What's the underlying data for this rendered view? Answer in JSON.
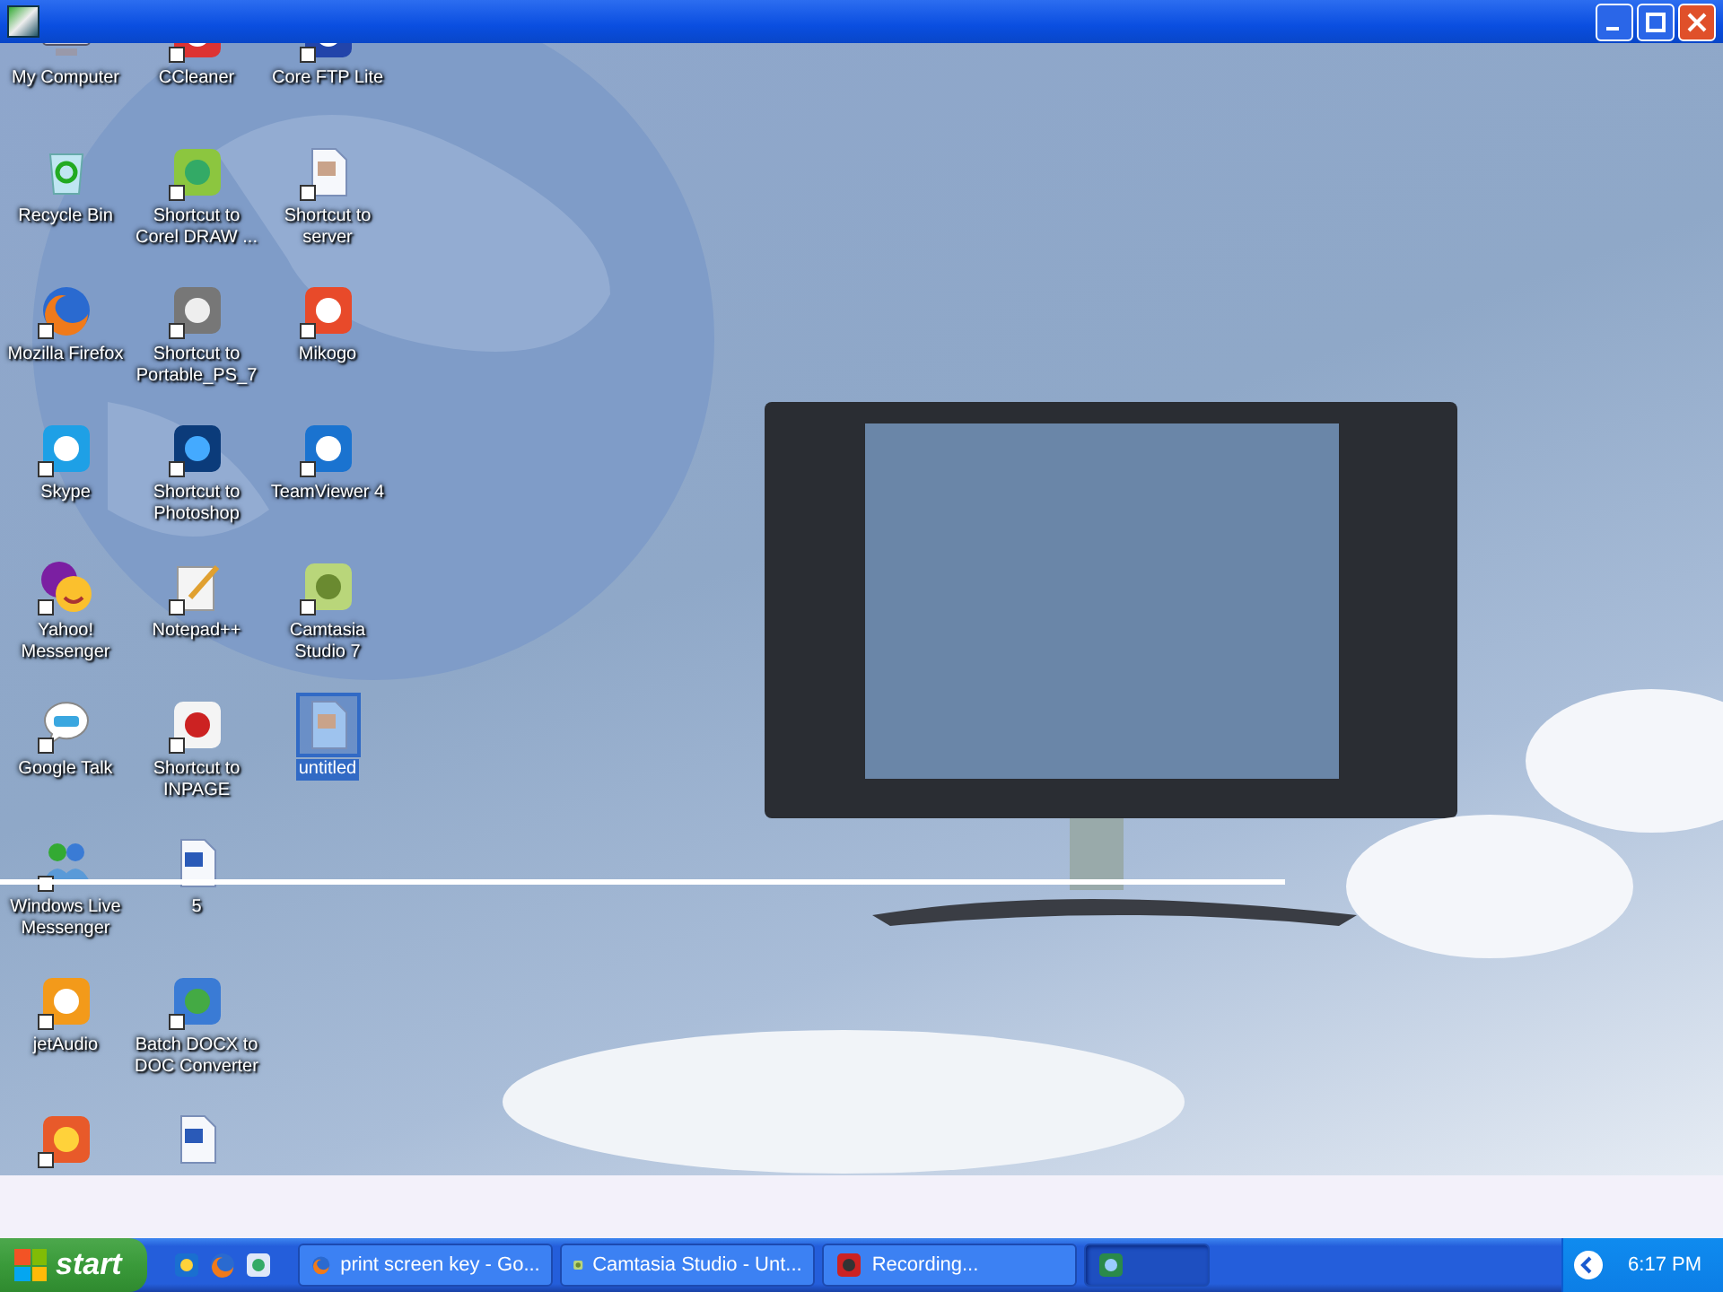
{
  "window": {
    "buttons": [
      {
        "kind": "minimize"
      },
      {
        "kind": "maximize"
      },
      {
        "kind": "close"
      }
    ]
  },
  "desktop_icons": [
    {
      "label": "My Computer",
      "kind": "computer",
      "shortcut": false,
      "selected": false
    },
    {
      "label": "Recycle Bin",
      "kind": "bin",
      "shortcut": false,
      "selected": false
    },
    {
      "label": "Mozilla Firefox",
      "kind": "browser",
      "shortcut": true,
      "selected": false
    },
    {
      "label": "Skype",
      "kind": "skype",
      "shortcut": true,
      "selected": false
    },
    {
      "label": "Yahoo! Messenger",
      "kind": "yahoo",
      "shortcut": true,
      "selected": false
    },
    {
      "label": "Google Talk",
      "kind": "talk",
      "shortcut": true,
      "selected": false
    },
    {
      "label": "Windows Live Messenger",
      "kind": "messenger",
      "shortcut": true,
      "selected": false
    },
    {
      "label": "jetAudio",
      "kind": "jetaudio",
      "shortcut": true,
      "selected": false
    },
    {
      "kind": "media",
      "shortcut": true,
      "selected": false
    },
    {
      "label": "CCleaner",
      "kind": "cleaner",
      "shortcut": true,
      "selected": false
    },
    {
      "label": "Shortcut to Corel DRAW ...",
      "kind": "corel",
      "shortcut": true,
      "selected": false
    },
    {
      "label": "Shortcut to Portable_PS_7",
      "kind": "ps",
      "shortcut": true,
      "selected": false
    },
    {
      "label": "Shortcut to Photoshop",
      "kind": "photoshop",
      "shortcut": true,
      "selected": false
    },
    {
      "label": "Notepad++",
      "kind": "notepad",
      "shortcut": true,
      "selected": false
    },
    {
      "label": "Shortcut to INPAGE",
      "kind": "inpage",
      "shortcut": true,
      "selected": false
    },
    {
      "label": "5",
      "kind": "word",
      "shortcut": false,
      "selected": false
    },
    {
      "label": "Batch DOCX to DOC Converter",
      "kind": "batch",
      "shortcut": true,
      "selected": false
    },
    {
      "kind": "word",
      "shortcut": false,
      "selected": false
    },
    {
      "label": "Core FTP Lite",
      "kind": "ftp",
      "shortcut": true,
      "selected": false
    },
    {
      "label": "Shortcut to server",
      "kind": "document",
      "shortcut": true,
      "selected": false
    },
    {
      "label": "Mikogo",
      "kind": "mikogo",
      "shortcut": true,
      "selected": false
    },
    {
      "label": "TeamViewer 4",
      "kind": "teamviewer",
      "shortcut": true,
      "selected": false
    },
    {
      "label": "Camtasia Studio 7",
      "kind": "camtasia",
      "shortcut": true,
      "selected": false
    },
    {
      "label": "untitled",
      "kind": "file",
      "shortcut": false,
      "selected": true
    }
  ],
  "taskbar": {
    "start": "start",
    "quick_launch": [
      {
        "kind": "ie"
      },
      {
        "kind": "browser"
      },
      {
        "kind": "desktop"
      }
    ],
    "tasks": [
      {
        "label": "print screen key - Go...",
        "kind": "browser",
        "selected": false
      },
      {
        "label": "Camtasia Studio - Unt...",
        "kind": "camtasia",
        "selected": false
      },
      {
        "label": "Recording...",
        "kind": "recording",
        "selected": false
      },
      {
        "kind": "image",
        "selected": true
      }
    ],
    "clock": "6:17 PM"
  }
}
